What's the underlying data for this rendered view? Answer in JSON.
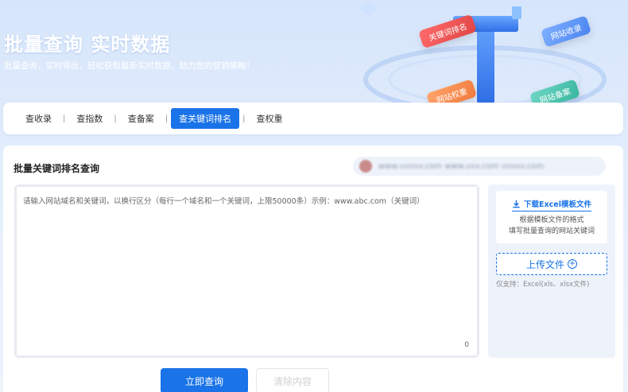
{
  "hero": {
    "title": "批量查询 实时数据",
    "subtitle": "批量查询，实时导出，轻松获取最新实时数据，助力您的营销策略！",
    "decor_tags": [
      "关键词排名",
      "网站收录",
      "网站权重",
      "网站备案"
    ]
  },
  "tabs": [
    {
      "label": "查收录",
      "active": false
    },
    {
      "label": "查指数",
      "active": false
    },
    {
      "label": "查备案",
      "active": false
    },
    {
      "label": "查关键词排名",
      "active": true
    },
    {
      "label": "查权重",
      "active": false
    }
  ],
  "tab_separator": "|",
  "panel": {
    "title": "批量关键词排名查询",
    "user_info": "www.vvvvv.com  www.vvv.com  vvvvv.com"
  },
  "textarea": {
    "placeholder": "请输入网站域名和关键词，以换行区分（每行一个域名和一个关键词，上限50000条）示例：www.abc.com（关键词）",
    "char_count": "0"
  },
  "upload": {
    "download_label": "下载Excel模板文件",
    "hint_line1": "根据模板文件的格式",
    "hint_line2": "填写批量查询的网站关键词",
    "upload_label": "上传文件",
    "support_text": "仅支持：Excel(xls、xlsx文件)"
  },
  "buttons": {
    "query": "立即查询",
    "clear": "清除内容"
  },
  "colors": {
    "primary": "#1a73e8",
    "hero_bg": "#d6e5fb"
  }
}
